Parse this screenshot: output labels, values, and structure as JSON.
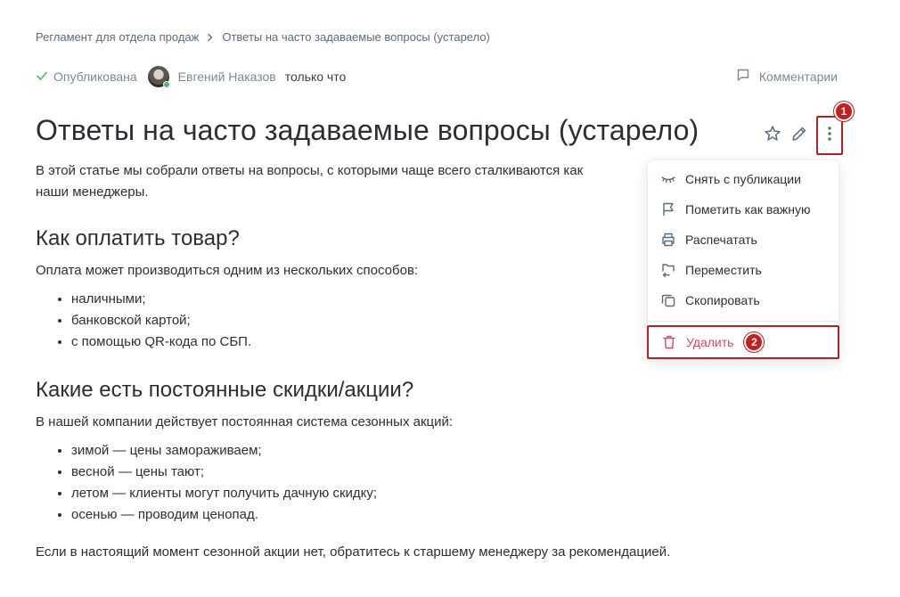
{
  "breadcrumb": {
    "parent": "Регламент для отдела продаж",
    "current": "Ответы на часто задаваемые вопросы (устарело)"
  },
  "meta": {
    "status": "Опубликована",
    "author": "Евгений Наказов",
    "time": "только что"
  },
  "comments_label": "Комментарии",
  "title": "Ответы на часто задаваемые вопросы (устарело)",
  "annotations": {
    "badge1": "1",
    "badge2": "2"
  },
  "article": {
    "intro": "В этой статье мы собрали ответы на вопросы, с которыми чаще всего сталкиваются как",
    "intro_line2": "наши менеджеры.",
    "section1": {
      "heading": "Как оплатить товар?",
      "text": "Оплата может производиться одним из нескольких способов:",
      "items": [
        "наличными;",
        "банковской картой;",
        "с помощью QR-кода по СБП."
      ]
    },
    "section2": {
      "heading": "Какие есть постоянные скидки/акции?",
      "text": "В нашей компании действует постоянная система сезонных акций:",
      "items": [
        "зимой — цены замораживаем;",
        "весной — цены тают;",
        "летом — клиенты могут получить дачную скидку;",
        "осенью — проводим ценопад."
      ]
    },
    "final": "Если в настоящий момент сезонной акции нет, обратитесь к старшему менеджеру за рекомендацией."
  },
  "menu": {
    "unpublish": "Снять с публикации",
    "mark_important": "Пометить как важную",
    "print": "Распечатать",
    "move": "Переместить",
    "copy": "Скопировать",
    "delete": "Удалить"
  },
  "colors": {
    "accent_green": "#4cbc5c",
    "danger": "#e0455a",
    "annotation_red": "#c41e1e"
  }
}
